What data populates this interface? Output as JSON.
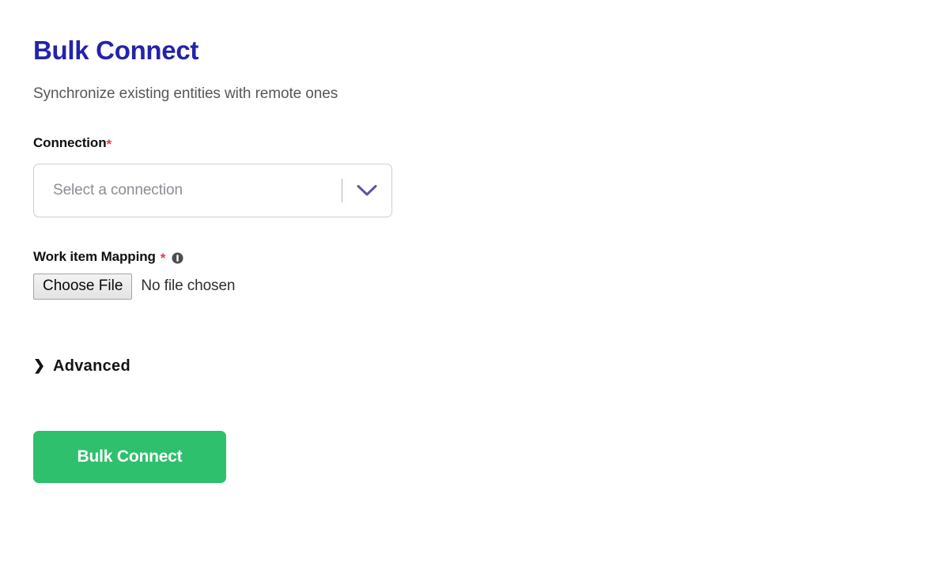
{
  "page": {
    "title": "Bulk Connect",
    "subtitle": "Synchronize existing entities with remote ones"
  },
  "form": {
    "connection": {
      "label": "Connection",
      "required_marker": "*",
      "placeholder": "Select a connection",
      "selected_value": "Select a connection",
      "chevron_icon": "chevron-down-icon"
    },
    "work_item_mapping": {
      "label": "Work item Mapping",
      "required_marker": "*",
      "info_icon": "info-icon",
      "choose_file_label": "Choose File",
      "file_status": "No file chosen"
    },
    "advanced": {
      "caret": "❯",
      "label": "Advanced",
      "expanded": false
    },
    "submit": {
      "label": "Bulk Connect"
    }
  },
  "colors": {
    "title": "#2323ab",
    "subtitle": "#575757",
    "required": "#e8384f",
    "accent_green": "#2ec06c",
    "select_border": "#cdcde0",
    "chevron": "#5b56a8",
    "info_icon": "#4e4e4e",
    "background": "#ffffff"
  }
}
